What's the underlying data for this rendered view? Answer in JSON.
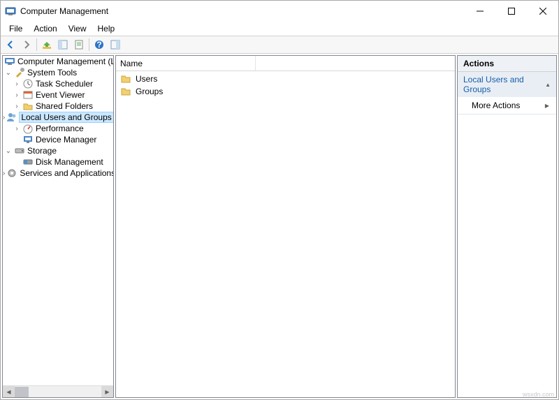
{
  "window": {
    "title": "Computer Management"
  },
  "menubar": {
    "file": "File",
    "action": "Action",
    "view": "View",
    "help": "Help"
  },
  "tree": {
    "root": "Computer Management (Local",
    "system_tools": "System Tools",
    "task_scheduler": "Task Scheduler",
    "event_viewer": "Event Viewer",
    "shared_folders": "Shared Folders",
    "local_users_and_groups": "Local Users and Groups",
    "performance": "Performance",
    "device_manager": "Device Manager",
    "storage": "Storage",
    "disk_management": "Disk Management",
    "services_and_applications": "Services and Applications"
  },
  "list": {
    "column_name": "Name",
    "items": {
      "users": "Users",
      "groups": "Groups"
    }
  },
  "actions": {
    "title": "Actions",
    "group_header": "Local Users and Groups",
    "more_actions": "More Actions"
  },
  "watermark": "wsxdn.com"
}
